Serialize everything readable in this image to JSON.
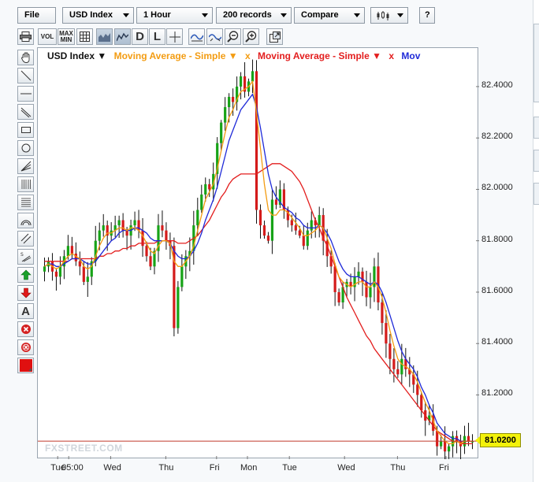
{
  "toolbar": {
    "file": "File",
    "symbol": "USD Index",
    "interval": "1 Hour",
    "records": "200 records",
    "compare": "Compare",
    "help": "?"
  },
  "toolbar2": {
    "vol_label": "VOL",
    "maxmin_label": "MAX\nMIN",
    "d_label": "D",
    "l_label": "L"
  },
  "tools": {
    "text_tool_label": "A"
  },
  "legend": {
    "symbol": "USD Index ▼",
    "ma1": "Moving Average - Simple ▼",
    "ma1_close": "x",
    "ma2": "Moving Average - Simple ▼",
    "ma2_close": "x",
    "ma3": "Mov",
    "ma1_color": "#f39c12",
    "ma2_color": "#e31e1e",
    "ma3_color": "#1f2ad8"
  },
  "current_price": "81.0200",
  "watermark": "FXSTREET.COM",
  "chart_data": {
    "type": "candlestick",
    "y_ticks": [
      "82.4000",
      "82.2000",
      "82.0000",
      "81.8000",
      "81.6000",
      "81.4000",
      "81.2000"
    ],
    "ylim": [
      80.95,
      82.55
    ],
    "x_ticks": [
      "Tue",
      "05:00",
      "Wed",
      "Thu",
      "Fri",
      "Mon",
      "Tue",
      "Wed",
      "Thu",
      "Fri"
    ],
    "current_price": 81.02,
    "close_series": [
      81.7,
      81.72,
      81.68,
      81.66,
      81.7,
      81.74,
      81.78,
      81.75,
      81.72,
      81.7,
      81.64,
      81.66,
      81.72,
      81.8,
      81.84,
      81.86,
      81.82,
      81.84,
      81.86,
      81.88,
      81.84,
      81.82,
      81.86,
      81.88,
      81.84,
      81.78,
      81.74,
      81.7,
      81.76,
      81.86,
      81.84,
      81.8,
      81.78,
      81.46,
      81.62,
      81.7,
      81.74,
      81.76,
      81.86,
      81.92,
      81.98,
      82.02,
      82.0,
      82.06,
      82.18,
      82.26,
      82.32,
      82.36,
      82.34,
      82.4,
      82.44,
      82.38,
      82.42,
      82.46,
      81.92,
      81.86,
      81.82,
      81.8,
      81.96,
      81.94,
      82.0,
      81.92,
      81.88,
      81.86,
      81.84,
      81.82,
      81.78,
      81.84,
      81.88,
      81.86,
      81.9,
      81.8,
      81.74,
      81.7,
      81.6,
      81.56,
      81.62,
      81.64,
      81.62,
      81.66,
      81.68,
      81.64,
      81.58,
      81.62,
      81.7,
      81.56,
      81.48,
      81.4,
      81.34,
      81.3,
      81.28,
      81.34,
      81.3,
      81.28,
      81.24,
      81.2,
      81.14,
      81.1,
      81.12,
      81.06,
      81.0,
      81.02,
      80.98,
      81.0,
      81.04,
      81.02,
      81.0,
      81.04,
      81.02,
      81.02
    ],
    "ma_fast": [
      81.7,
      81.71,
      81.7,
      81.69,
      81.7,
      81.72,
      81.74,
      81.75,
      81.74,
      81.73,
      81.7,
      81.69,
      81.7,
      81.74,
      81.78,
      81.81,
      81.83,
      81.83,
      81.84,
      81.85,
      81.85,
      81.84,
      81.85,
      81.85,
      81.84,
      81.82,
      81.79,
      81.76,
      81.75,
      81.78,
      81.8,
      81.8,
      81.79,
      81.72,
      81.7,
      81.7,
      81.72,
      81.74,
      81.78,
      81.84,
      81.9,
      81.96,
      81.99,
      82.02,
      82.08,
      82.15,
      82.22,
      82.28,
      82.31,
      82.35,
      82.38,
      82.39,
      82.4,
      82.42,
      82.3,
      82.16,
      82.02,
      81.92,
      81.9,
      81.9,
      81.92,
      81.92,
      81.91,
      81.89,
      81.87,
      81.85,
      81.82,
      81.82,
      81.83,
      81.84,
      81.86,
      81.85,
      81.81,
      81.77,
      81.71,
      81.66,
      81.64,
      81.63,
      81.62,
      81.63,
      81.64,
      81.64,
      81.62,
      81.62,
      81.64,
      81.62,
      81.58,
      81.52,
      81.45,
      81.39,
      81.34,
      81.32,
      81.31,
      81.3,
      81.28,
      81.25,
      81.21,
      81.17,
      81.14,
      81.1,
      81.06,
      81.04,
      81.02,
      81.01,
      81.01,
      81.02,
      81.01,
      81.02,
      81.02,
      81.02
    ],
    "ma_mid": [
      81.7,
      81.71,
      81.71,
      81.7,
      81.7,
      81.71,
      81.72,
      81.73,
      81.73,
      81.73,
      81.72,
      81.71,
      81.71,
      81.72,
      81.74,
      81.76,
      81.78,
      81.8,
      81.81,
      81.83,
      81.84,
      81.84,
      81.84,
      81.85,
      81.85,
      81.84,
      81.83,
      81.81,
      81.8,
      81.8,
      81.8,
      81.8,
      81.79,
      81.76,
      81.74,
      81.73,
      81.73,
      81.74,
      81.76,
      81.79,
      81.83,
      81.88,
      81.92,
      81.96,
      82.01,
      82.07,
      82.13,
      82.19,
      82.23,
      82.27,
      82.31,
      82.33,
      82.35,
      82.37,
      82.32,
      82.24,
      82.15,
      82.06,
      82.0,
      81.97,
      81.95,
      81.93,
      81.92,
      81.91,
      81.89,
      81.88,
      81.86,
      81.85,
      81.85,
      81.85,
      81.86,
      81.85,
      81.83,
      81.8,
      81.76,
      81.72,
      81.69,
      81.67,
      81.66,
      81.66,
      81.66,
      81.65,
      81.64,
      81.63,
      81.64,
      81.63,
      81.6,
      81.56,
      81.51,
      81.46,
      81.41,
      81.37,
      81.34,
      81.32,
      81.3,
      81.27,
      81.23,
      81.2,
      81.16,
      81.13,
      81.09,
      81.07,
      81.05,
      81.04,
      81.03,
      81.03,
      81.02,
      81.02,
      81.02,
      81.02
    ],
    "ma_slow": [
      81.72,
      81.72,
      81.72,
      81.72,
      81.72,
      81.72,
      81.72,
      81.73,
      81.73,
      81.73,
      81.73,
      81.73,
      81.73,
      81.73,
      81.74,
      81.74,
      81.75,
      81.75,
      81.76,
      81.76,
      81.77,
      81.77,
      81.78,
      81.78,
      81.79,
      81.79,
      81.79,
      81.79,
      81.79,
      81.8,
      81.8,
      81.8,
      81.8,
      81.8,
      81.79,
      81.79,
      81.79,
      81.8,
      81.81,
      81.82,
      81.84,
      81.86,
      81.88,
      81.91,
      81.94,
      81.97,
      81.99,
      82.02,
      82.04,
      82.05,
      82.06,
      82.06,
      82.06,
      82.06,
      82.06,
      82.07,
      82.08,
      82.09,
      82.1,
      82.1,
      82.1,
      82.09,
      82.08,
      82.07,
      82.05,
      82.03,
      82.0,
      81.96,
      81.92,
      81.88,
      81.85,
      81.81,
      81.78,
      81.74,
      81.7,
      81.66,
      81.62,
      81.58,
      81.55,
      81.52,
      81.49,
      81.46,
      81.43,
      81.41,
      81.38,
      81.36,
      81.34,
      81.32,
      81.3,
      81.28,
      81.26,
      81.24,
      81.22,
      81.2,
      81.18,
      81.16,
      81.14,
      81.12,
      81.1,
      81.08,
      81.06,
      81.05,
      81.04,
      81.03,
      81.02,
      81.02,
      81.01,
      81.01,
      81.01,
      81.01
    ],
    "grid": false,
    "legend_position": "top"
  }
}
